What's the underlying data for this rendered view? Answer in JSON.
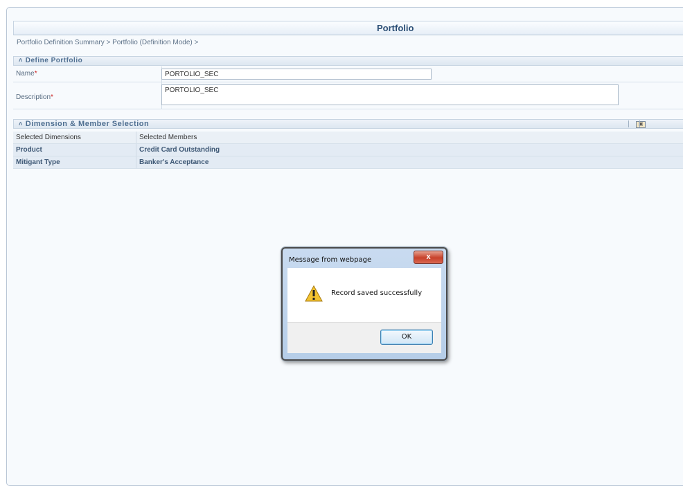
{
  "header": {
    "title": "Portfolio"
  },
  "breadcrumb": "Portfolio Definition Summary > Portfolio (Definition Mode) >",
  "define_portfolio": {
    "section_label": "Define Portfolio",
    "name_label": "Name",
    "name_value": "PORTOLIO_SEC",
    "description_label": "Description",
    "description_value": "PORTOLIO_SEC",
    "required_marker": "*"
  },
  "dimension_selection": {
    "section_label": "Dimension & Member Selection",
    "columns": [
      "Selected Dimensions",
      "Selected Members"
    ],
    "rows": [
      {
        "dimension": "Product",
        "members": "Credit Card Outstanding"
      },
      {
        "dimension": "Mitigant Type",
        "members": "Banker's Acceptance"
      }
    ]
  },
  "dialog": {
    "title": "Message from webpage",
    "close_glyph": "x",
    "message": "Record saved successfully",
    "ok_label": "OK",
    "icon": "warning-icon"
  },
  "colors": {
    "title_text": "#2c4f76",
    "required": "#cc2222",
    "close_button": "#c7412a"
  }
}
